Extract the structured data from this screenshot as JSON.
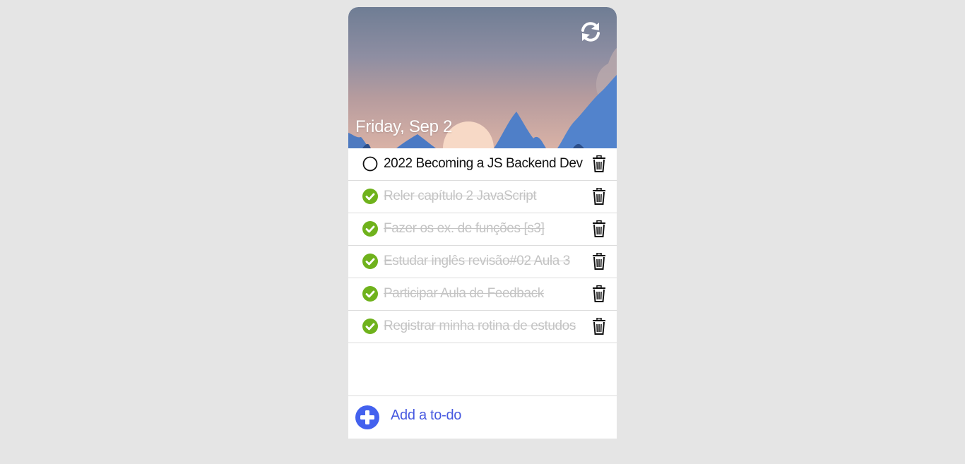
{
  "header": {
    "date": "Friday, Sep 2",
    "refresh_icon": "refresh-icon"
  },
  "tasks": [
    {
      "text": "2022 Becoming a JS Backend Dev",
      "done": false
    },
    {
      "text": "Reler capítulo 2 JavaScript",
      "done": true
    },
    {
      "text": "Fazer os ex. de funções [s3]",
      "done": true
    },
    {
      "text": "Estudar inglês revisão#02 Aula 3",
      "done": true
    },
    {
      "text": "Participar Aula de Feedback",
      "done": true
    },
    {
      "text": "Registrar minha rotina de estudos",
      "done": true
    }
  ],
  "footer": {
    "add_label": "Add a to-do",
    "add_icon": "plus-icon"
  },
  "colors": {
    "background": "#e5e5e5",
    "done_check": "#6fb21c",
    "accent": "#4361ee",
    "done_text": "#c4c4c4"
  }
}
